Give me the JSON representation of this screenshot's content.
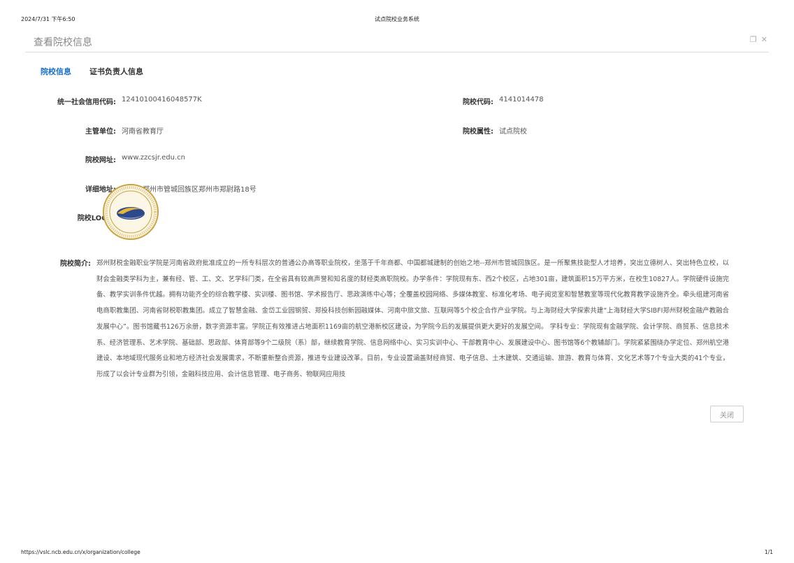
{
  "print_header": {
    "datetime": "2024/7/31 下午6:50",
    "page_title": "试点院校业务系统"
  },
  "print_footer": {
    "url": "https://vslc.ncb.edu.cn/x/organization/college",
    "page_num": "1/1"
  },
  "dialog": {
    "title": "查看院校信息",
    "icons": {
      "maximize": "restore-icon",
      "close": "close-icon"
    }
  },
  "tabs": [
    {
      "label": "院校信息",
      "active": true
    },
    {
      "label": "证书负责人信息",
      "active": false
    }
  ],
  "fields": {
    "credit_code": {
      "label": "统一社会信用代码:",
      "value": "12410100416048577K"
    },
    "school_code": {
      "label": "院校代码:",
      "value": "4141014478"
    },
    "authority": {
      "label": "主管单位:",
      "value": "河南省教育厅"
    },
    "attribute": {
      "label": "院校属性:",
      "value": "试点院校"
    },
    "website": {
      "label": "院校网址:",
      "value": "www.zzcsjr.edu.cn"
    },
    "address": {
      "label": "详细地址:",
      "value": "河南省郑州市管城回族区郑州市郑尉路18号"
    },
    "logo": {
      "label": "院校LOGO:"
    },
    "intro": {
      "label": "院校简介:",
      "text": "郑州财税金融职业学院是河南省政府批准成立的一所专科层次的普通公办高等职业院校，坐落于千年商都、中国都城建制的创始之地--郑州市管城回族区。是一所聚焦技能型人才培养，突出立德树人、突出特色立校，以财会金融类学科为主，兼有经、管、工、文、艺学科门类，在全省具有较高声誉和知名度的财经类高职院校。办学条件：学院现有东、西2个校区，占地301亩，建筑面积15万平方米，在校生10827人。学院硬件设施完备、教学实训条件优越。拥有功能齐全的综合教学楼、实训楼、图书馆、学术报告厅、思政演练中心等；全覆盖校园网络、多媒体教室、标准化考场、电子阅览室和智慧教室等现代化教育教学设施齐全。牵头组建河南省电商职教集团、河南省财税职教集团。成立了智慧金融、金岱工业园钢贸、郑投科技创新园融媒体、河南中旅文旅、互联网等5个校企合作产业学院。与上海财经大学探索共建“上海财经大学SIBFI郑州财税金融产教融合发展中心”。图书馆藏书126万余册，数字资源丰富。学院正有效推进占地面积1169亩的航空港新校区建设，为学院今后的发展提供更大更好的发展空间。 学科专业：学院现有金融学院、会计学院、商贸系、信息技术系、经济管理系、艺术学院、基础部、思政部、体育部等9个二级院（系）部，继续教育学院、信息网络中心、实习实训中心、干部教育中心、发展建设中心、图书馆等6个教辅部门。学院紧紧围绕办学定位、郑州航空港建设、本地域现代服务业和地方经济社会发展需求，不断重新整合资源，推进专业建设改革。目前，专业设置涵盖财经商贸、电子信息、土木建筑、交通运输、旅游、教育与体育、文化艺术等7个专业大类的41个专业，形成了以会计专业群为引领，金融科技应用、会计信息管理、电子商务、物联网应用技"
    }
  },
  "close_button": {
    "label": "关闭"
  },
  "colors": {
    "accent": "#1a6fce",
    "logo_gold": "#c9a33a",
    "logo_blue": "#2b4a8c"
  }
}
